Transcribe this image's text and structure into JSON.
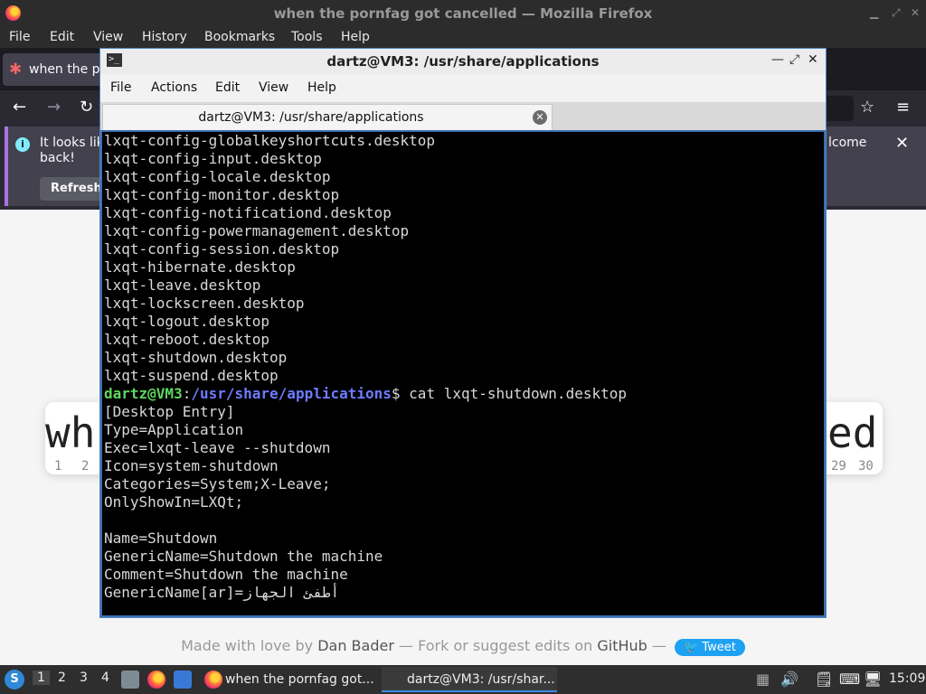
{
  "firefox": {
    "window_title": "when the pornfag got cancelled — Mozilla Firefox",
    "menu": [
      "File",
      "Edit",
      "View",
      "History",
      "Bookmarks",
      "Tools",
      "Help"
    ],
    "tab_label": "when the po",
    "notice": {
      "text_line1": "It looks lik",
      "text_line2": "back!",
      "text_right": "lcome",
      "refresh_label": "Refresh"
    },
    "page": {
      "heading_left": "wh",
      "heading_right": "ed",
      "nums_left": [
        "1",
        "2"
      ],
      "nums_right": [
        "29",
        "30"
      ],
      "footer": {
        "made_with": "Made with love by",
        "author": "Dan Bader",
        "fork_text": "— Fork or suggest edits on",
        "github": "GitHub",
        "dash": "—",
        "tweet": "Tweet"
      }
    }
  },
  "terminal": {
    "window_title": "dartz@VM3: /usr/share/applications",
    "menu": [
      "File",
      "Actions",
      "Edit",
      "View",
      "Help"
    ],
    "tab_label": "dartz@VM3: /usr/share/applications",
    "lines_before": [
      "lxqt-config-globalkeyshortcuts.desktop",
      "lxqt-config-input.desktop",
      "lxqt-config-locale.desktop",
      "lxqt-config-monitor.desktop",
      "lxqt-config-notificationd.desktop",
      "lxqt-config-powermanagement.desktop",
      "lxqt-config-session.desktop",
      "lxqt-hibernate.desktop",
      "lxqt-leave.desktop",
      "lxqt-lockscreen.desktop",
      "lxqt-logout.desktop",
      "lxqt-reboot.desktop",
      "lxqt-shutdown.desktop",
      "lxqt-suspend.desktop"
    ],
    "prompt": {
      "user_host": "dartz@VM3",
      "colon": ":",
      "path": "/usr/share/applications",
      "command": "$ cat lxqt-shutdown.desktop"
    },
    "lines_after": [
      "[Desktop Entry]",
      "Type=Application",
      "Exec=lxqt-leave --shutdown",
      "Icon=system-shutdown",
      "Categories=System;X-Leave;",
      "OnlyShowIn=LXQt;",
      "",
      "Name=Shutdown",
      "GenericName=Shutdown the machine",
      "Comment=Shutdown the machine",
      "GenericName[ar]=أطفئ الجهاز"
    ]
  },
  "taskbar": {
    "workspaces": [
      "1",
      "2",
      "3",
      "4"
    ],
    "tasks": [
      {
        "label": "when the pornfag got..."
      },
      {
        "label": "dartz@VM3: /usr/shar..."
      }
    ],
    "clock": "15:09"
  }
}
